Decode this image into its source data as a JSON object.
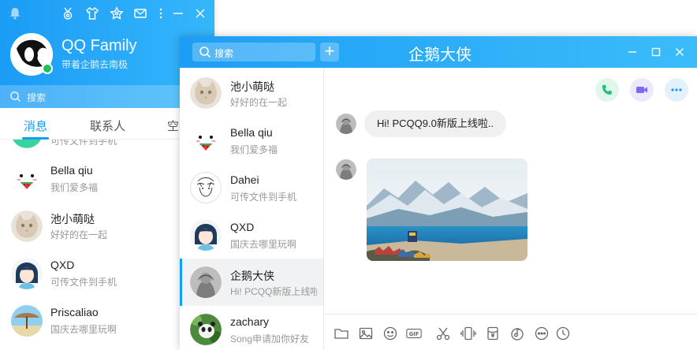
{
  "main_window": {
    "nickname": "QQ Family",
    "signature": "带着企鹅去南极",
    "search_placeholder": "搜索",
    "tabs": [
      {
        "label": "消息",
        "active": true
      },
      {
        "label": "联系人",
        "active": false
      },
      {
        "label": "空",
        "active": false
      }
    ],
    "partial_preview": "可传文件到手机",
    "contacts": [
      {
        "name": "Bella qiu",
        "preview": "我们爱多福",
        "avatar": "watermelon-face"
      },
      {
        "name": "池小萌哒",
        "preview": "好好的在一起",
        "avatar": "cat"
      },
      {
        "name": "QXD",
        "preview": "可传文件到手机",
        "avatar": "girl-cartoon"
      },
      {
        "name": "Priscaliao",
        "preview": "国庆去哪里玩啊",
        "avatar": "beach-umbrella"
      }
    ]
  },
  "chat_window": {
    "title": "企鹅大侠",
    "search_placeholder": "搜索",
    "add_label": "+",
    "conversations": [
      {
        "name": "池小萌哒",
        "preview": "好好的在一起",
        "avatar": "cat",
        "active": false
      },
      {
        "name": "Bella qiu",
        "preview": "我们爱多福",
        "avatar": "watermelon-face",
        "active": false
      },
      {
        "name": "Dahei",
        "preview": "可传文件到手机",
        "avatar": "sketch-boy",
        "active": false
      },
      {
        "name": "QXD",
        "preview": "国庆去哪里玩啊",
        "avatar": "girl-cartoon",
        "active": false
      },
      {
        "name": "企鹅大侠",
        "preview": "Hi! PCQQ新版上线啦..",
        "avatar": "gray-portrait",
        "active": true
      },
      {
        "name": "zachary",
        "preview": "Song申请加你好友",
        "avatar": "panda",
        "active": false
      }
    ],
    "messages": [
      {
        "type": "text",
        "text": "Hi!  PCQQ9.0新版上线啦.."
      },
      {
        "type": "image",
        "alt": "snowy-mountains-lake-photo"
      }
    ],
    "header_actions": [
      "phone-icon",
      "video-camera-icon",
      "more-icon"
    ],
    "toolbar_icons": [
      "folder-icon",
      "image-icon",
      "emoji-icon",
      "gif-icon",
      "scissors-icon",
      "shake-icon",
      "red-packet-icon",
      "music-icon",
      "more-circle-icon",
      "history-icon"
    ],
    "toolbar_gif_label": "GIF",
    "colors": {
      "header_blue": "#1d9ef6",
      "accent_blue": "#12a0f3",
      "online_green": "#20c05c",
      "phone_green": "#1fc27a",
      "video_purple": "#7a6cf0"
    }
  }
}
